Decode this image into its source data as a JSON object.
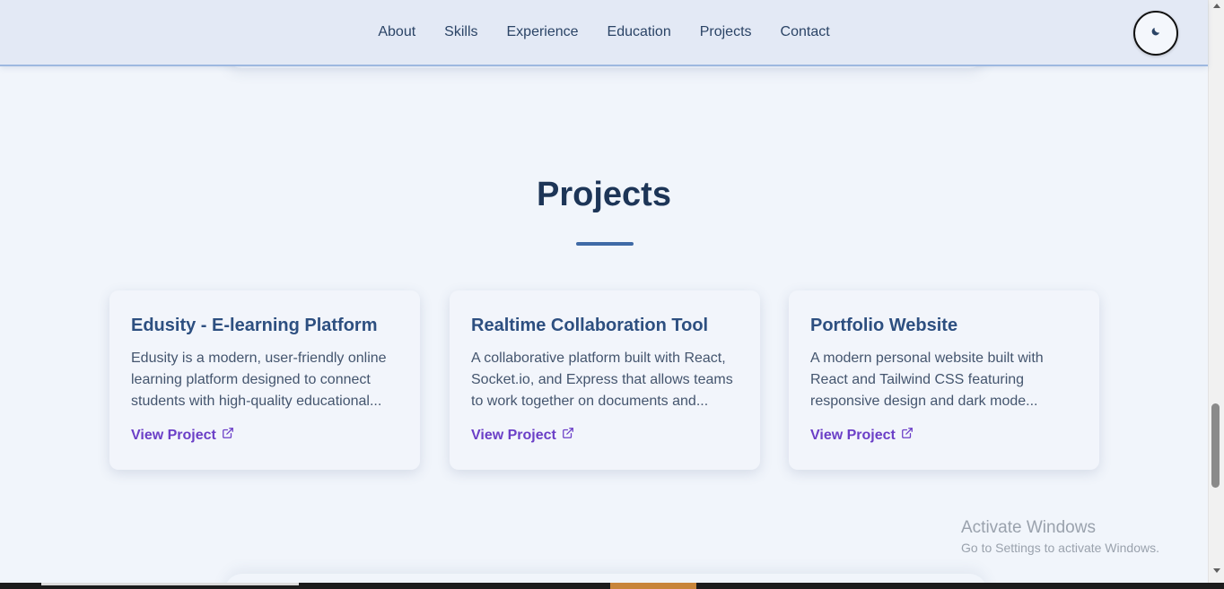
{
  "nav": {
    "links": [
      "About",
      "Skills",
      "Experience",
      "Education",
      "Projects",
      "Contact"
    ],
    "theme_toggle_icon": "moon-icon"
  },
  "projects": {
    "title": "Projects",
    "accent_color": "#3f6aa6",
    "items": [
      {
        "title": "Edusity - E-learning Platform",
        "description": "Edusity is a modern, user-friendly online learning platform designed to connect students with high-quality educational...",
        "link_label": "View Project",
        "link_icon": "external-link-icon"
      },
      {
        "title": "Realtime Collaboration Tool",
        "description": "A collaborative platform built with React, Socket.io, and Express that allows teams to work together on documents and...",
        "link_label": "View Project",
        "link_icon": "external-link-icon"
      },
      {
        "title": "Portfolio Website",
        "description": "A modern personal website built with React and Tailwind CSS featuring responsive design and dark mode...",
        "link_label": "View Project",
        "link_icon": "external-link-icon"
      }
    ]
  },
  "watermark": {
    "title": "Activate Windows",
    "subtitle": "Go to Settings to activate Windows."
  },
  "colors": {
    "page_bg": "#f1f5fb",
    "nav_bg": "#e3e9f5",
    "heading": "#1d3557",
    "card_title": "#2d4f80",
    "link": "#6b3fc7"
  }
}
